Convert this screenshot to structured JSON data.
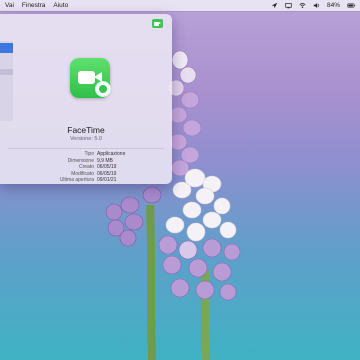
{
  "menubar": {
    "items": [
      "Vai",
      "Finestra",
      "Aiuto"
    ],
    "battery": "84%",
    "icons": [
      "location-icon",
      "display-icon",
      "wifi-icon",
      "volume-icon",
      "battery-icon"
    ]
  },
  "window": {
    "app_name": "FaceTime",
    "version": "Versione: 5.0",
    "info": [
      {
        "label": "Tipo",
        "value": "Applicazione"
      },
      {
        "label": "Dimensione",
        "value": "9,9 MB"
      },
      {
        "label": "Creato",
        "value": "06/05/19"
      },
      {
        "label": "Modificato",
        "value": "06/05/19"
      },
      {
        "label": "Ultima apertura",
        "value": "09/01/21"
      }
    ]
  },
  "colors": {
    "accent": "#3d78e0",
    "facetime_green": "#35c553"
  }
}
